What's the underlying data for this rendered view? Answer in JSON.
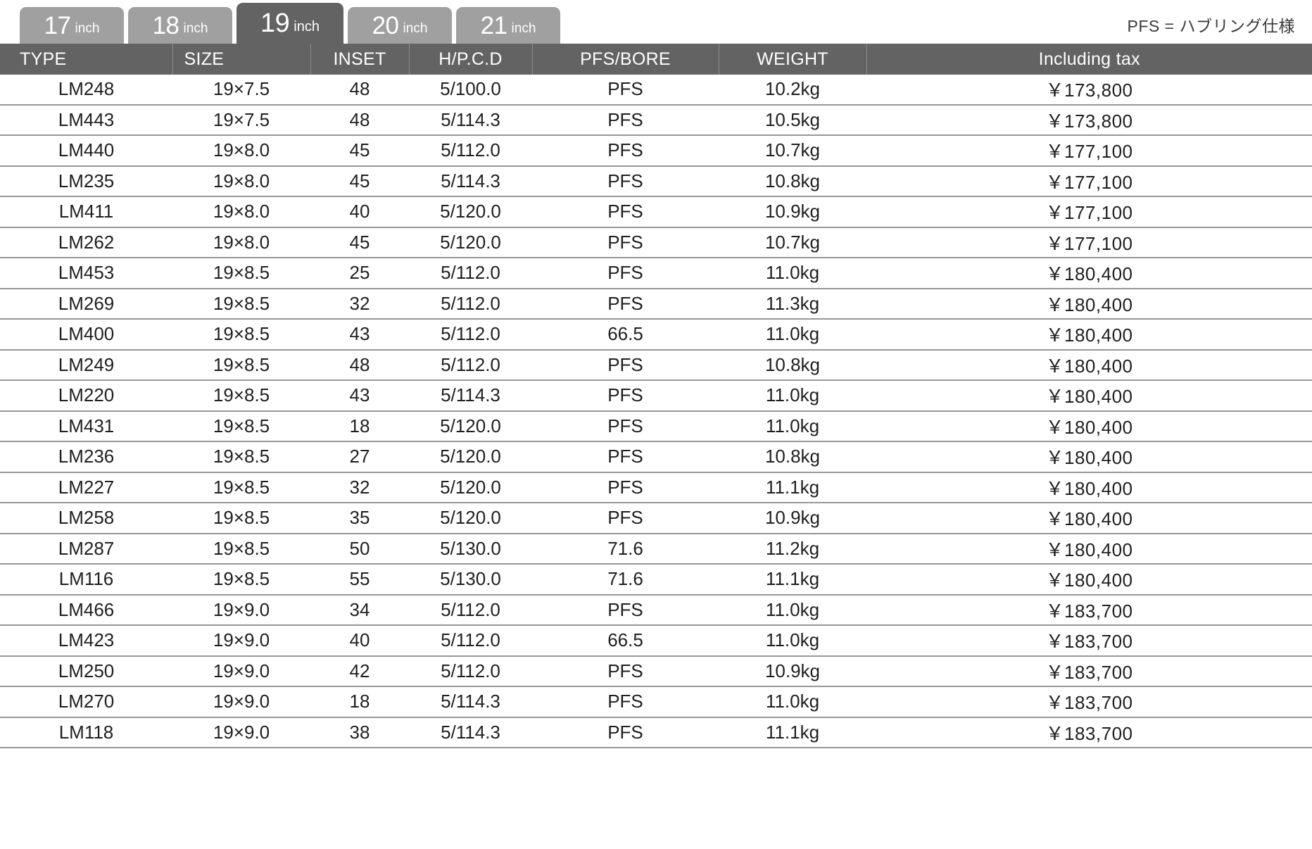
{
  "tabs": [
    {
      "number": "17",
      "unit": "inch",
      "active": false
    },
    {
      "number": "18",
      "unit": "inch",
      "active": false
    },
    {
      "number": "19",
      "unit": "inch",
      "active": true
    },
    {
      "number": "20",
      "unit": "inch",
      "active": false
    },
    {
      "number": "21",
      "unit": "inch",
      "active": false
    }
  ],
  "note": "PFS = ハブリング仕様",
  "table": {
    "headers": [
      "TYPE",
      "SIZE",
      "INSET",
      "H/P.C.D",
      "PFS/BORE",
      "WEIGHT",
      "Including tax"
    ],
    "rows": [
      {
        "type": "LM248",
        "size": "19×7.5",
        "inset": "48",
        "pcd": "5/100.0",
        "bore": "PFS",
        "weight": "10.2kg",
        "price": "￥173,800"
      },
      {
        "type": "LM443",
        "size": "19×7.5",
        "inset": "48",
        "pcd": "5/114.3",
        "bore": "PFS",
        "weight": "10.5kg",
        "price": "￥173,800"
      },
      {
        "type": "LM440",
        "size": "19×8.0",
        "inset": "45",
        "pcd": "5/112.0",
        "bore": "PFS",
        "weight": "10.7kg",
        "price": "￥177,100"
      },
      {
        "type": "LM235",
        "size": "19×8.0",
        "inset": "45",
        "pcd": "5/114.3",
        "bore": "PFS",
        "weight": "10.8kg",
        "price": "￥177,100"
      },
      {
        "type": "LM411",
        "size": "19×8.0",
        "inset": "40",
        "pcd": "5/120.0",
        "bore": "PFS",
        "weight": "10.9kg",
        "price": "￥177,100"
      },
      {
        "type": "LM262",
        "size": "19×8.0",
        "inset": "45",
        "pcd": "5/120.0",
        "bore": "PFS",
        "weight": "10.7kg",
        "price": "￥177,100"
      },
      {
        "type": "LM453",
        "size": "19×8.5",
        "inset": "25",
        "pcd": "5/112.0",
        "bore": "PFS",
        "weight": "11.0kg",
        "price": "￥180,400"
      },
      {
        "type": "LM269",
        "size": "19×8.5",
        "inset": "32",
        "pcd": "5/112.0",
        "bore": "PFS",
        "weight": "11.3kg",
        "price": "￥180,400"
      },
      {
        "type": "LM400",
        "size": "19×8.5",
        "inset": "43",
        "pcd": "5/112.0",
        "bore": "66.5",
        "weight": "11.0kg",
        "price": "￥180,400"
      },
      {
        "type": "LM249",
        "size": "19×8.5",
        "inset": "48",
        "pcd": "5/112.0",
        "bore": "PFS",
        "weight": "10.8kg",
        "price": "￥180,400"
      },
      {
        "type": "LM220",
        "size": "19×8.5",
        "inset": "43",
        "pcd": "5/114.3",
        "bore": "PFS",
        "weight": "11.0kg",
        "price": "￥180,400"
      },
      {
        "type": "LM431",
        "size": "19×8.5",
        "inset": "18",
        "pcd": "5/120.0",
        "bore": "PFS",
        "weight": "11.0kg",
        "price": "￥180,400"
      },
      {
        "type": "LM236",
        "size": "19×8.5",
        "inset": "27",
        "pcd": "5/120.0",
        "bore": "PFS",
        "weight": "10.8kg",
        "price": "￥180,400"
      },
      {
        "type": "LM227",
        "size": "19×8.5",
        "inset": "32",
        "pcd": "5/120.0",
        "bore": "PFS",
        "weight": "11.1kg",
        "price": "￥180,400"
      },
      {
        "type": "LM258",
        "size": "19×8.5",
        "inset": "35",
        "pcd": "5/120.0",
        "bore": "PFS",
        "weight": "10.9kg",
        "price": "￥180,400"
      },
      {
        "type": "LM287",
        "size": "19×8.5",
        "inset": "50",
        "pcd": "5/130.0",
        "bore": "71.6",
        "weight": "11.2kg",
        "price": "￥180,400"
      },
      {
        "type": "LM116",
        "size": "19×8.5",
        "inset": "55",
        "pcd": "5/130.0",
        "bore": "71.6",
        "weight": "11.1kg",
        "price": "￥180,400"
      },
      {
        "type": "LM466",
        "size": "19×9.0",
        "inset": "34",
        "pcd": "5/112.0",
        "bore": "PFS",
        "weight": "11.0kg",
        "price": "￥183,700"
      },
      {
        "type": "LM423",
        "size": "19×9.0",
        "inset": "40",
        "pcd": "5/112.0",
        "bore": "66.5",
        "weight": "11.0kg",
        "price": "￥183,700"
      },
      {
        "type": "LM250",
        "size": "19×9.0",
        "inset": "42",
        "pcd": "5/112.0",
        "bore": "PFS",
        "weight": "10.9kg",
        "price": "￥183,700"
      },
      {
        "type": "LM270",
        "size": "19×9.0",
        "inset": "18",
        "pcd": "5/114.3",
        "bore": "PFS",
        "weight": "11.0kg",
        "price": "￥183,700"
      },
      {
        "type": "LM118",
        "size": "19×9.0",
        "inset": "38",
        "pcd": "5/114.3",
        "bore": "PFS",
        "weight": "11.1kg",
        "price": "￥183,700"
      }
    ]
  },
  "colors": {
    "tab_active": "#636363",
    "tab_inactive": "#a0a0a0",
    "header_bg": "#636363",
    "row_divider": "#969696"
  }
}
